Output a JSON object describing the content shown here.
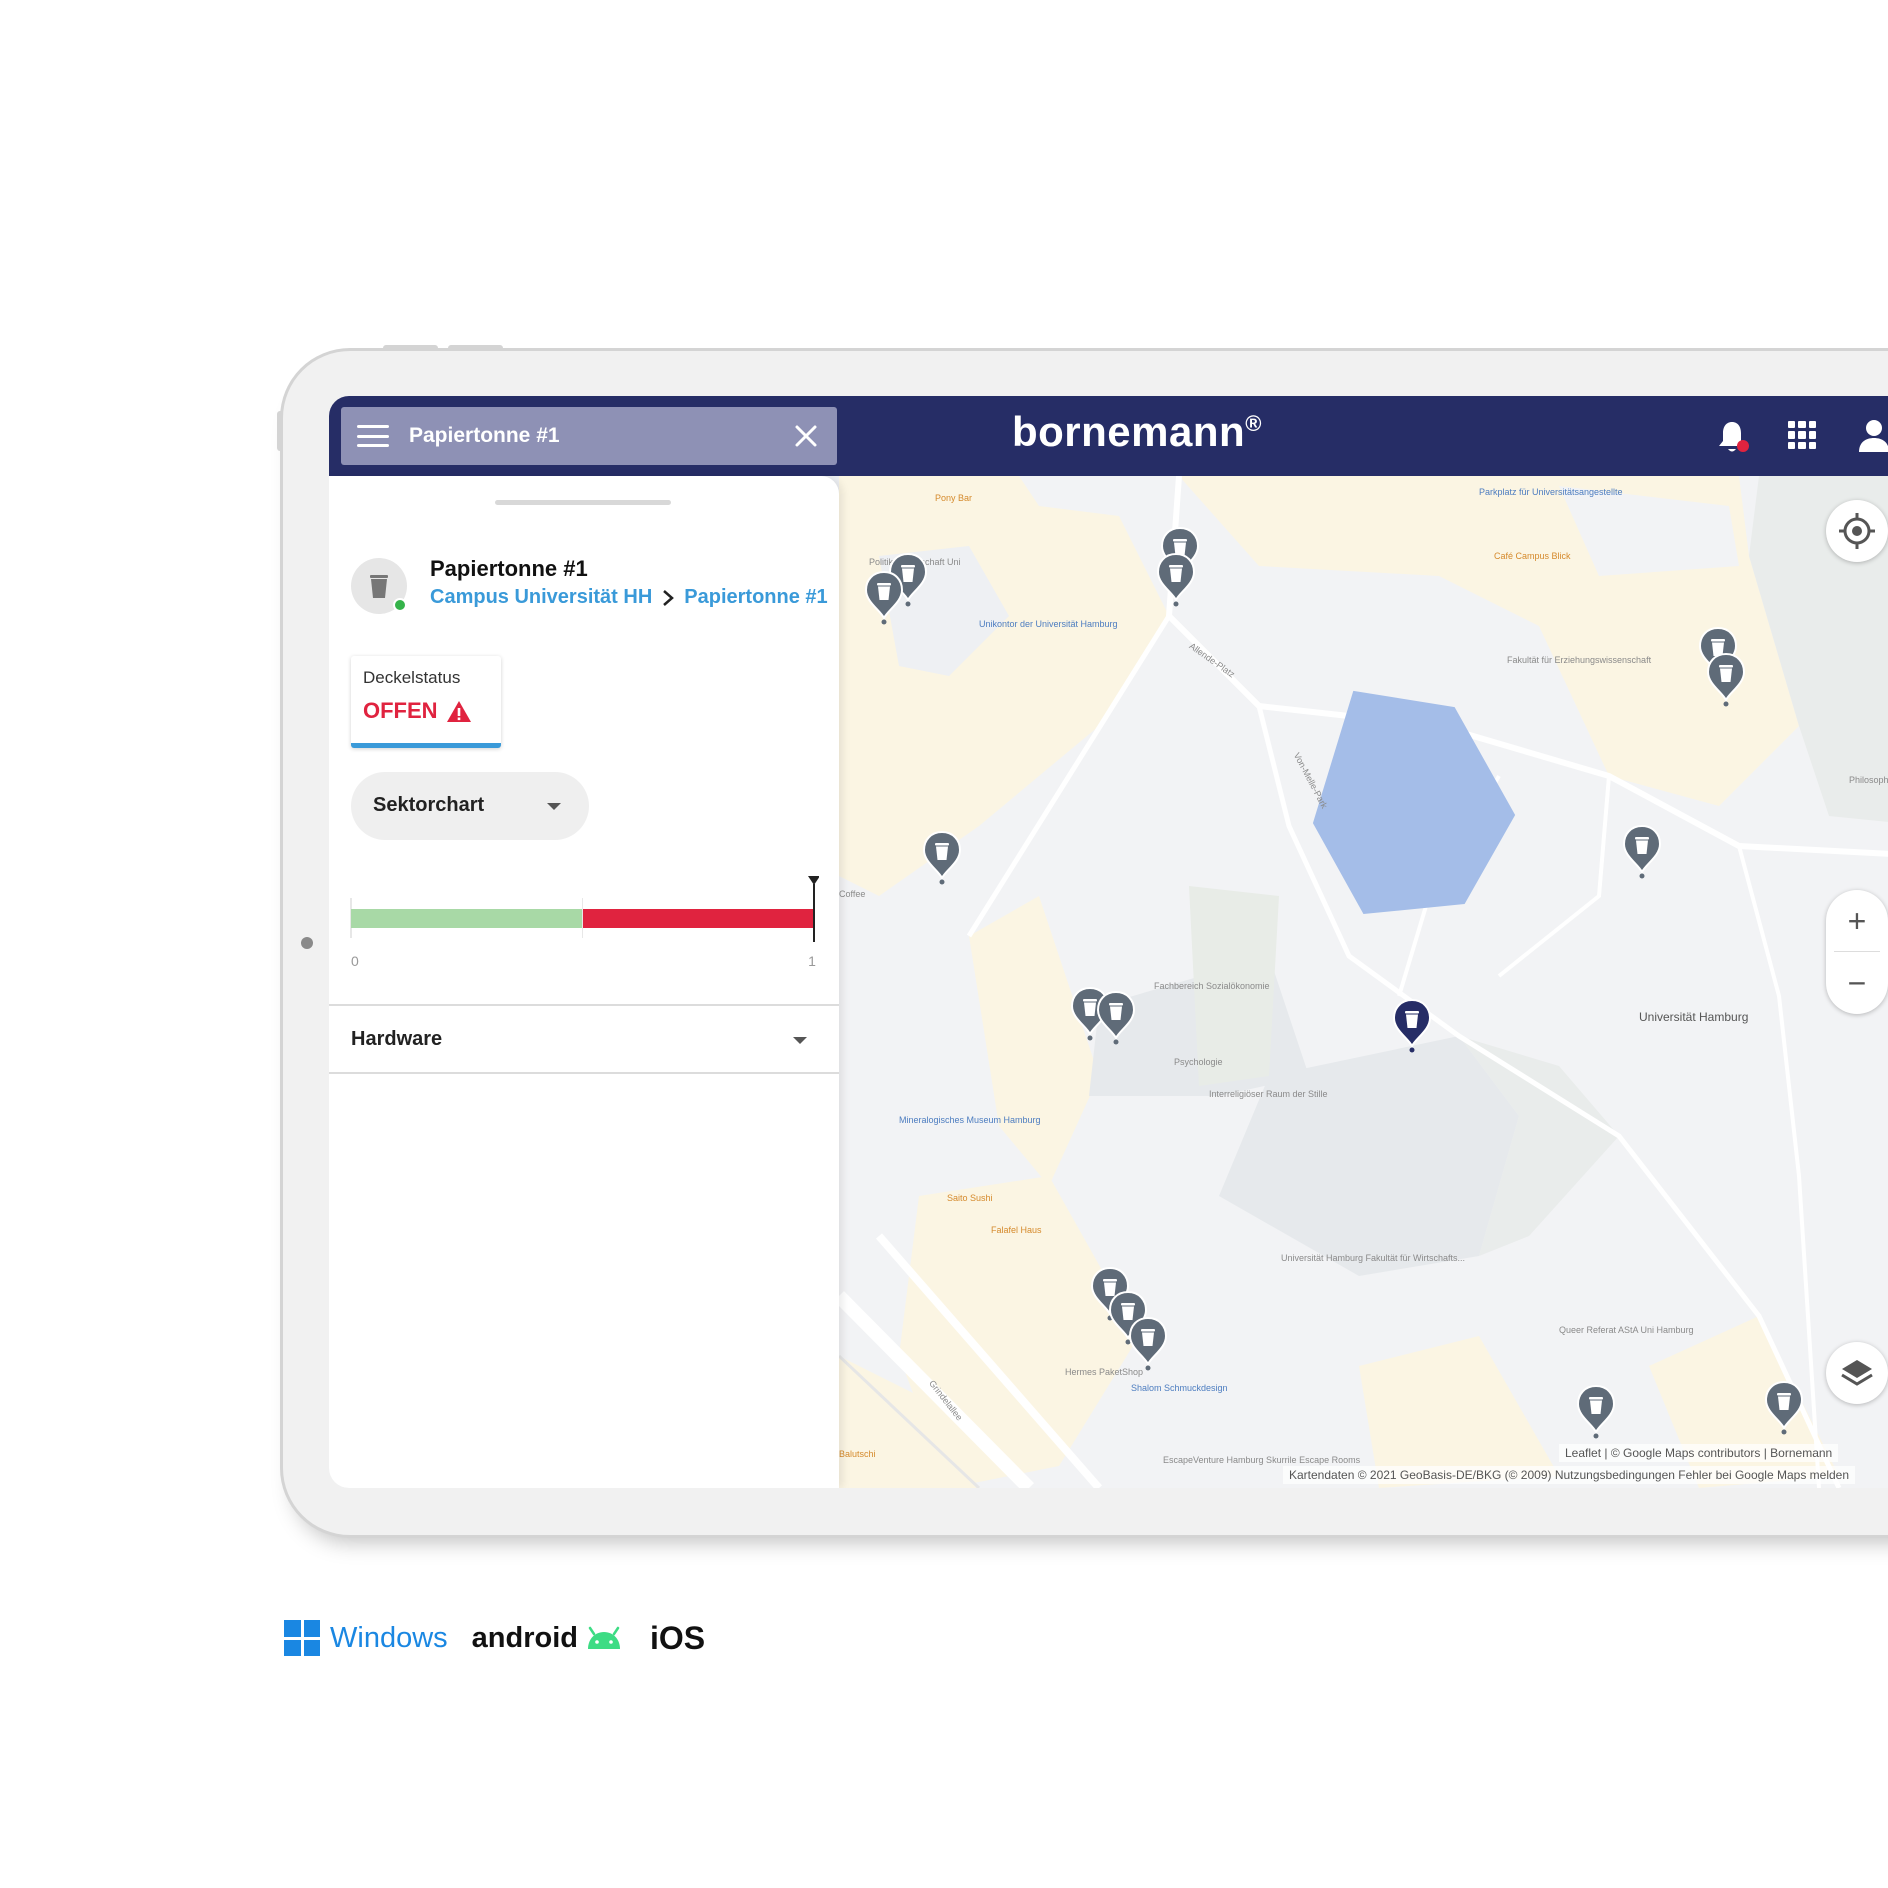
{
  "header": {
    "search_value": "Papiertonne #1",
    "brand": "bornemann",
    "brand_mark": "®"
  },
  "panel": {
    "title": "Papiertonne #1",
    "breadcrumb": [
      "Campus Universität HH",
      "Papiertonne #1"
    ],
    "status_card": {
      "label": "Deckelstatus",
      "value": "OFFEN"
    },
    "chart_selector": "Sektorchart",
    "hardware_label": "Hardware"
  },
  "chart_data": {
    "type": "bar",
    "orientation": "horizontal",
    "xlim": [
      0,
      1
    ],
    "tick_labels": [
      "0",
      "1"
    ],
    "segments": [
      {
        "from": 0,
        "to": 0.5,
        "color": "#a8d9a6"
      },
      {
        "from": 0.5,
        "to": 1,
        "color": "#e0233f"
      }
    ],
    "marker_value": 1
  },
  "map": {
    "labels": [
      {
        "text": "Pony Bar",
        "style": "orange"
      },
      {
        "text": "Parkplatz für Universitätsangestellte",
        "style": "blue"
      },
      {
        "text": "Café Campus Blick",
        "style": "orange"
      },
      {
        "text": "Politikwissenschaft Uni",
        "style": "grey"
      },
      {
        "text": "Unikontor der Universität Hamburg",
        "style": "blue"
      },
      {
        "text": "Fakultät für Erziehungswissenschaft",
        "style": "grey"
      },
      {
        "text": "Coffee",
        "style": "grey"
      },
      {
        "text": "Fachbereich Sozialökonomie",
        "style": "grey"
      },
      {
        "text": "Psychologie",
        "style": "grey"
      },
      {
        "text": "Interreligiöser Raum der Stille",
        "style": "grey"
      },
      {
        "text": "Mineralogisches Museum Hamburg",
        "style": "blue"
      },
      {
        "text": "Saito Sushi",
        "style": "orange"
      },
      {
        "text": "Falafel Haus",
        "style": "orange"
      },
      {
        "text": "Universität Hamburg Fakultät für Wirtschafts...",
        "style": "grey"
      },
      {
        "text": "Universität Hamburg",
        "style": "dark"
      },
      {
        "text": "Queer Referat AStA Uni Hamburg",
        "style": "grey"
      },
      {
        "text": "Hermes PaketShop",
        "style": "grey"
      },
      {
        "text": "Shalom Schmuckdesign",
        "style": "blue"
      },
      {
        "text": "EscapeVenture Hamburg Skurrile Escape Rooms",
        "style": "grey"
      },
      {
        "text": "Balutschi",
        "style": "orange"
      },
      {
        "text": "Philosophen",
        "style": "grey"
      },
      {
        "text": "Von-Melle-Park",
        "style": "grey"
      },
      {
        "text": "Allende-Platz",
        "style": "grey"
      },
      {
        "text": "Grindelallee",
        "style": "grey"
      }
    ],
    "attribution": "Leaflet | © Google Maps contributors | Bornemann",
    "attribution2": "Kartendaten © 2021 GeoBasis-DE/BKG (© 2009)   Nutzungsbedingungen   Fehler bei Google Maps melden",
    "zoom_in": "+",
    "zoom_out": "−",
    "controls": [
      "locate-icon",
      "layers-icon"
    ]
  },
  "platforms": {
    "windows": "Windows",
    "android": "android",
    "ios": "iOS"
  },
  "colors": {
    "header_bg": "#262d66",
    "accent_blue": "#3a9ad9",
    "alert_red": "#e0233f",
    "online_green": "#35b34a"
  }
}
